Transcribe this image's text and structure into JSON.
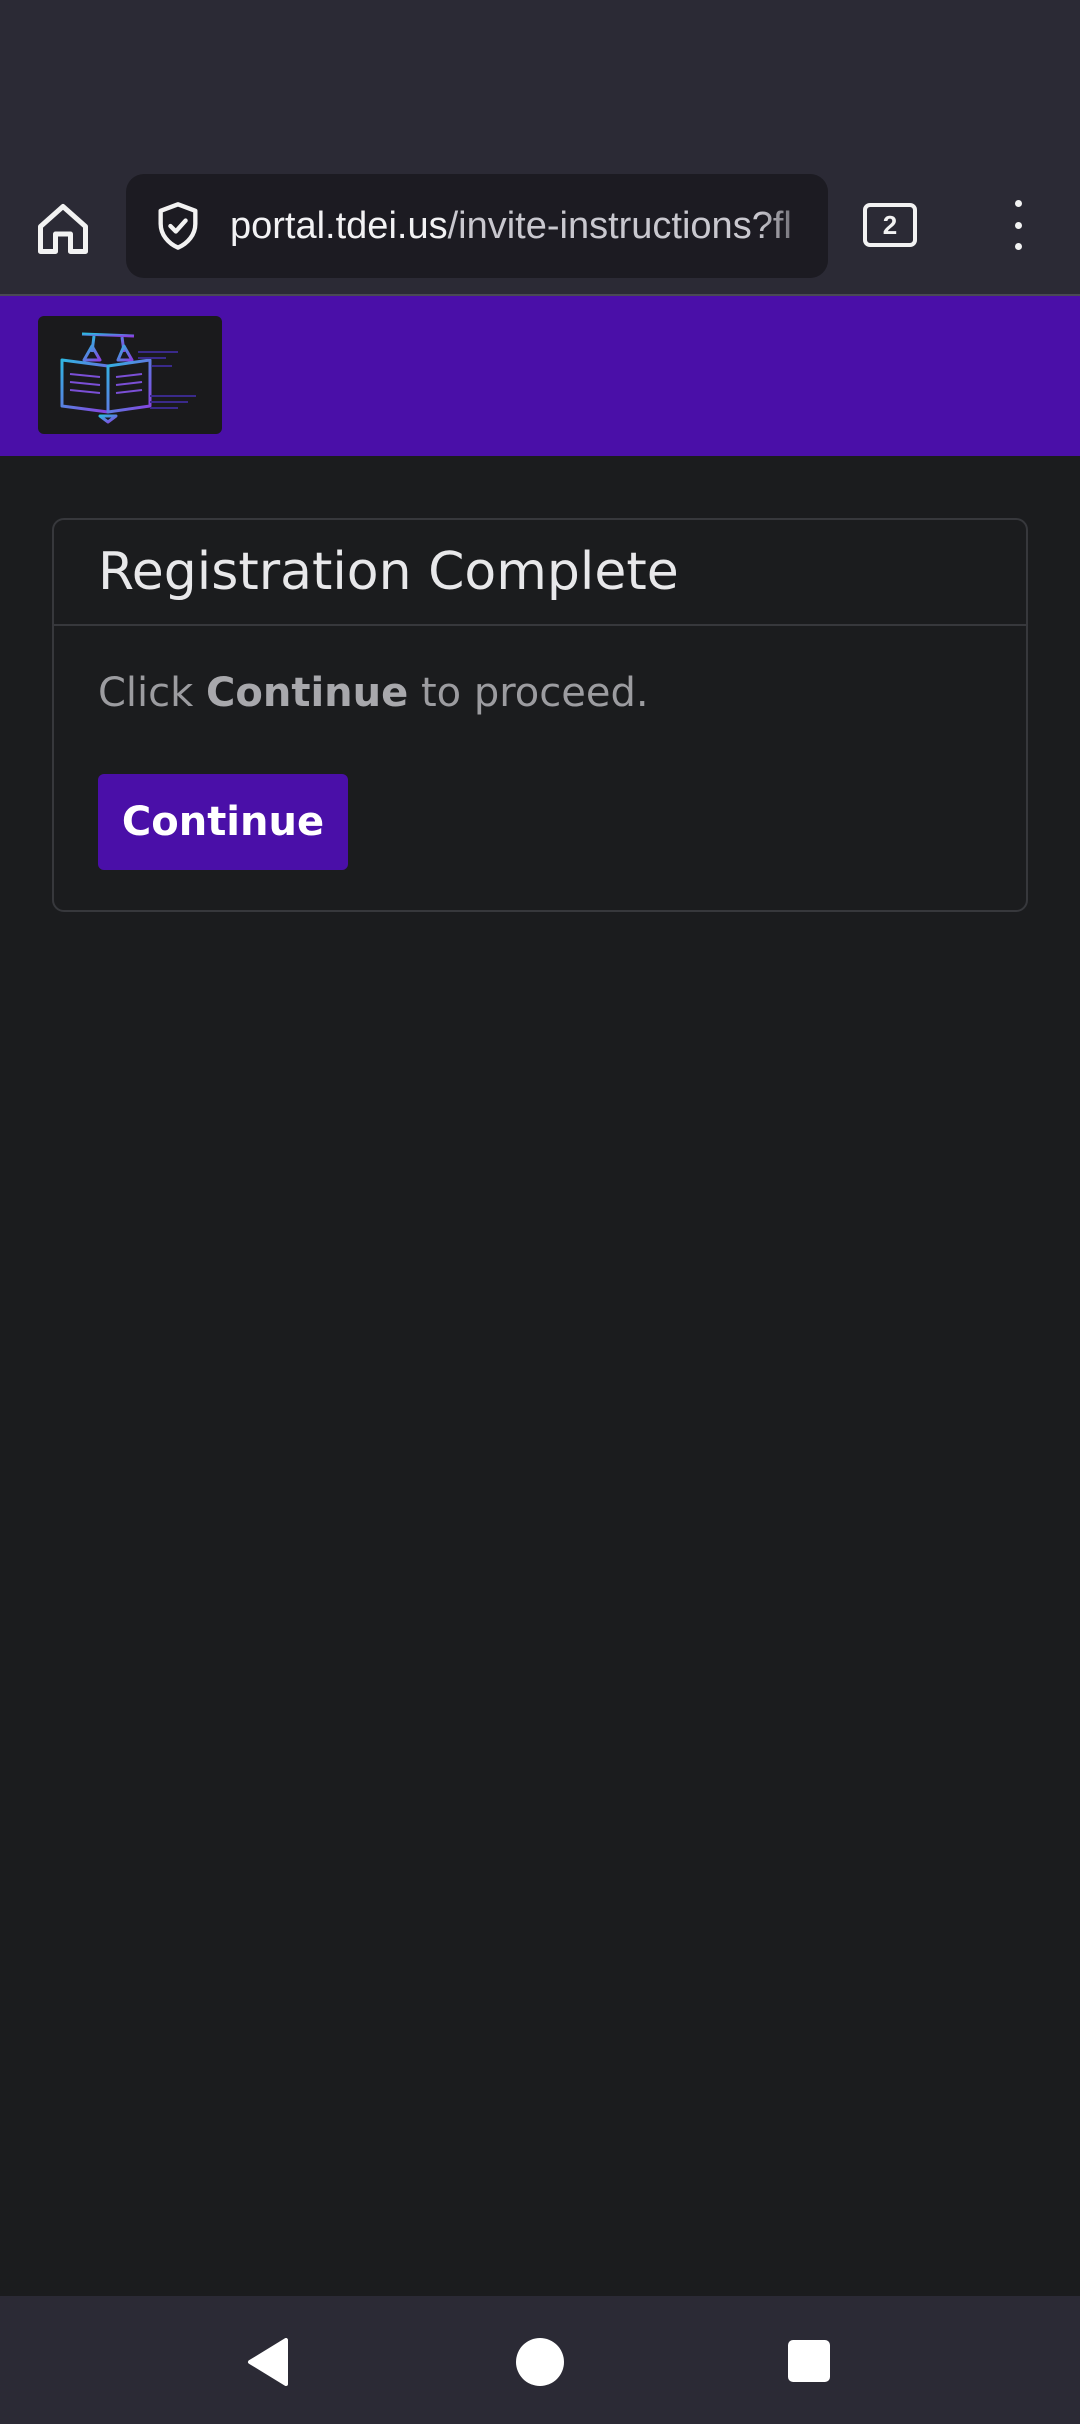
{
  "browser": {
    "url_host": "portal.tdei.us",
    "url_path": "/invite-instructions?fl",
    "tab_count": "2",
    "icons": {
      "home": "home-icon",
      "security": "shield-check-icon",
      "menu": "more-vert-icon"
    }
  },
  "card": {
    "title": "Registration Complete",
    "body_prefix": "Click ",
    "body_bold": "Continue",
    "body_suffix": " to proceed.",
    "button_label": "Continue"
  },
  "colors": {
    "brand_purple": "#4a0fa8",
    "page_background": "#1b1c1e",
    "browser_chrome": "#2b2a35"
  },
  "system_nav": {
    "icons": [
      "back-icon",
      "home-circle-icon",
      "recent-apps-icon"
    ]
  }
}
